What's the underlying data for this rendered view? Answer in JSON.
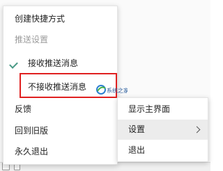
{
  "main_menu": {
    "items": [
      {
        "label": "创建快捷方式"
      },
      {
        "label": "推送设置"
      },
      {
        "label": "接收推送消息"
      },
      {
        "label": "不接收推送消息"
      },
      {
        "label": "反馈"
      },
      {
        "label": "回到旧版"
      },
      {
        "label": "永久退出"
      }
    ]
  },
  "sub_menu": {
    "items": [
      {
        "label": "显示主界面"
      },
      {
        "label": "设置"
      },
      {
        "label": "退出"
      }
    ]
  },
  "watermark": {
    "text": "系统之家"
  },
  "colors": {
    "checkmark": "#4a9a86",
    "highlight_border": "#e02020",
    "disabled_text": "#9c9c9c",
    "hover_bg": "#ececec"
  }
}
